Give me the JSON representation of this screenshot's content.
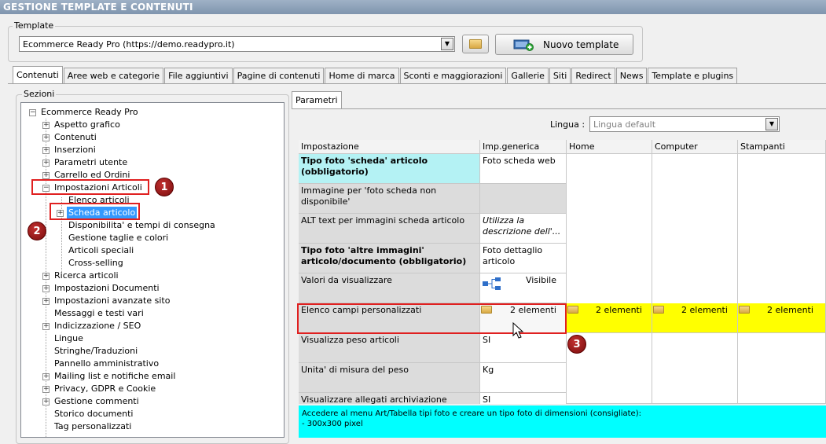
{
  "window": {
    "title": "GESTIONE TEMPLATE E CONTENUTI"
  },
  "template_group": {
    "label": "Template",
    "selected": "Ecommerce Ready Pro (https://demo.readypro.it)",
    "new_button": "Nuovo template"
  },
  "tabs": [
    "Contenuti",
    "Aree web e categorie",
    "File aggiuntivi",
    "Pagine di contenuti",
    "Home di marca",
    "Sconti e maggiorazioni",
    "Gallerie",
    "Siti",
    "Redirect",
    "News",
    "Template e plugins"
  ],
  "sections": {
    "label": "Sezioni",
    "root": "Ecommerce Ready Pro",
    "items": [
      "Aspetto grafico",
      "Contenuti",
      "Inserzioni",
      "Parametri utente",
      "Carrello ed Ordini",
      "Impostazioni Articoli",
      "Elenco articoli",
      "Scheda articolo",
      "Disponibilita' e tempi di consegna",
      "Gestione taglie e colori",
      "Articoli speciali",
      "Cross-selling",
      "Ricerca articoli",
      "Impostazioni Documenti",
      "Impostazioni avanzate sito",
      "Messaggi e testi vari",
      "Indicizzazione / SEO",
      "Lingue",
      "Stringhe/Traduzioni",
      "Pannello amministrativo",
      "Mailing list e notifiche email",
      "Privacy, GDPR e Cookie",
      "Gestione commenti",
      "Storico documenti",
      "Tag personalizzati"
    ]
  },
  "right_panel": {
    "tab": "Parametri",
    "lingua_label": "Lingua :",
    "lingua_placeholder": "Lingua default",
    "columns": [
      "Impostazione",
      "Imp.generica",
      "Home",
      "Computer",
      "Stampanti"
    ],
    "rows": [
      {
        "name": "Tipo foto 'scheda' articolo (obbligatorio)",
        "value": "Foto scheda web"
      },
      {
        "name": "Immagine per 'foto scheda non disponibile'",
        "value": ""
      },
      {
        "name": "ALT text per immagini scheda articolo",
        "value": "Utilizza la descrizione dell'..."
      },
      {
        "name": "Tipo foto 'altre immagini' articolo/documento (obbligatorio)",
        "value": "Foto dettaglio articolo"
      },
      {
        "name": "Valori da visualizzare",
        "value": "Visibile"
      },
      {
        "name": "Elenco campi personalizzati",
        "value": "2 elementi",
        "home": "2 elementi",
        "computer": "2 elementi",
        "stampanti": "2 elementi"
      },
      {
        "name": "Visualizza peso articoli",
        "value": "SI"
      },
      {
        "name": "Unita' di misura del peso",
        "value": "Kg"
      },
      {
        "name": "Visualizzare allegati archiviazione",
        "value": "SI"
      }
    ],
    "info_text": "Accedere al menu Art/Tabella tipi foto e creare un tipo foto di dimensioni (consigliate):",
    "info_text2": "- 300x300 pixel"
  },
  "callouts": [
    "1",
    "2",
    "3"
  ],
  "icons": [
    "folder-icon",
    "new-template-icon",
    "tree-node-icon",
    "cursor-icon"
  ]
}
